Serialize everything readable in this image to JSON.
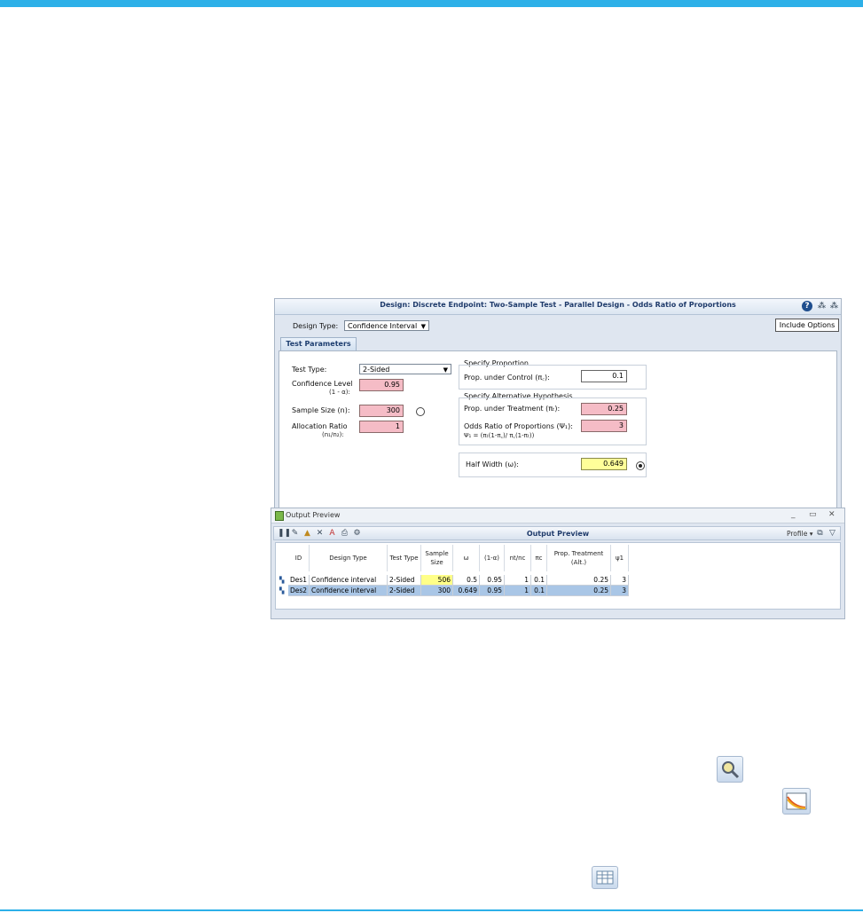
{
  "design_window": {
    "title": "Design: Discrete Endpoint: Two-Sample Test - Parallel Design - Odds Ratio of Proportions",
    "design_type_label": "Design Type:",
    "design_type_value": "Confidence Interval",
    "include_options": "Include Options",
    "tab_label": "Test Parameters",
    "test_type_label": "Test Type:",
    "test_type_value": "2-Sided",
    "confidence_label": "Confidence Level",
    "confidence_sub": "(1 - α):",
    "confidence_value": "0.95",
    "sample_size_label": "Sample Size (n):",
    "sample_size_value": "300",
    "allocation_label": "Allocation Ratio",
    "allocation_sub": "(n₁/n₂):",
    "allocation_value": "1",
    "specify_proportion": "Specify Proportion",
    "prop_control_label": "Prop. under Control (π꜀):",
    "prop_control_value": "0.1",
    "specify_alt": "Specify Alternative Hypothesis",
    "prop_treatment_label": "Prop. under Treatment (πₜ):",
    "prop_treatment_value": "0.25",
    "odds_ratio_label": "Odds Ratio of Proportions (Ψ₁):",
    "odds_ratio_value": "3",
    "odds_formula": "Ψ₁ = (πₜ(1-π꜀)/ π꜀(1-πₜ))",
    "half_width_label": "Half Width (ω):",
    "half_width_value": "0.649"
  },
  "output_preview": {
    "window_title": "Output Preview",
    "bar_title": "Output Preview",
    "profile_label": "Profile",
    "columns": [
      "ID",
      "Design Type",
      "Test Type",
      "Sample Size",
      "ω",
      "(1-α)",
      "nt/nc",
      "πc",
      "Prop. Treatment (Alt.)",
      "ψ1"
    ],
    "rows": [
      [
        "Des1",
        "Confidence interval",
        "2-Sided",
        "506",
        "0.5",
        "0.95",
        "1",
        "0.1",
        "0.25",
        "3"
      ],
      [
        "Des2",
        "Confidence interval",
        "2-Sided",
        "300",
        "0.649",
        "0.95",
        "1",
        "0.1",
        "0.25",
        "3"
      ]
    ]
  },
  "colors": {
    "accent": "#2db0e8",
    "input_pink": "#f5bcc6",
    "input_yellow": "#ffff99",
    "selected_row": "#a9c6e6"
  }
}
